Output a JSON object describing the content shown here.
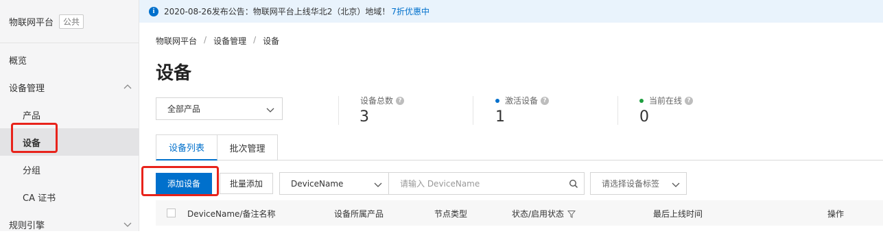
{
  "sidebar": {
    "title": "物联网平台",
    "badge": "公共",
    "items": [
      {
        "label": "概览"
      },
      {
        "label": "设备管理"
      },
      {
        "label": "产品"
      },
      {
        "label": "设备"
      },
      {
        "label": "分组"
      },
      {
        "label": "CA 证书"
      },
      {
        "label": "规则引擎"
      }
    ]
  },
  "notice": {
    "icon": "info-icon",
    "text": "2020-08-26发布公告：物联网平台上线华北2（北京）地域！",
    "link": "7折优惠中"
  },
  "breadcrumb": [
    "物联网平台",
    "设备管理",
    "设备"
  ],
  "page_title": "设备",
  "product_filter": {
    "value": "全部产品"
  },
  "stats": [
    {
      "label": "设备总数",
      "value": "3"
    },
    {
      "label": "激活设备",
      "value": "1",
      "dot_color": "#0070cc"
    },
    {
      "label": "当前在线",
      "value": "0",
      "dot_color": "#1e9e3f"
    }
  ],
  "tabs": [
    {
      "label": "设备列表",
      "active": true
    },
    {
      "label": "批次管理",
      "active": false
    }
  ],
  "toolbar": {
    "add_label": "添加设备",
    "batch_label": "批量添加",
    "field_select": "DeviceName",
    "search_placeholder": "请输入 DeviceName",
    "tag_placeholder": "请选择设备标签"
  },
  "table": {
    "columns": [
      "DeviceName/备注名称",
      "设备所属产品",
      "节点类型",
      "状态/启用状态",
      "最后上线时间",
      "操作"
    ]
  },
  "colors": {
    "accent": "#0070cc",
    "highlight": "#e8231b"
  }
}
